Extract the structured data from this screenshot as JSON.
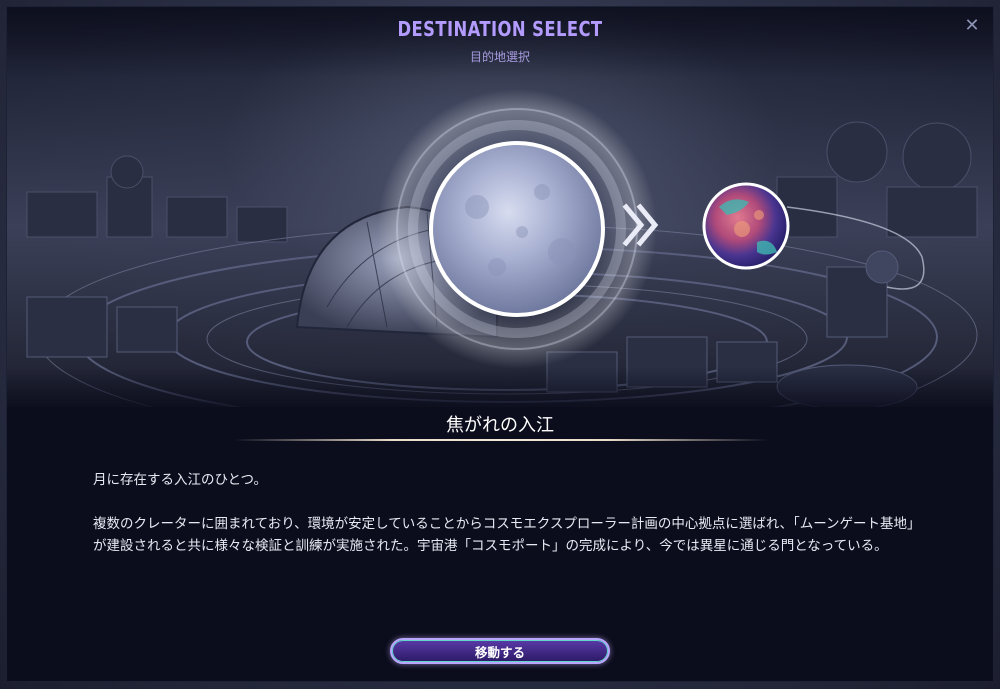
{
  "header": {
    "title": "DESTINATION SELECT",
    "subtitle": "目的地選択",
    "close_glyph": "✕"
  },
  "destination": {
    "name": "焦がれの入江",
    "description": [
      "月に存在する入江のひとつ。",
      "複数のクレーターに囲まれており、環境が安定していることからコスモエクスプローラー計画の中心拠点に選ばれ、「ムーンゲート基地」が建設されると共に様々な検証と訓練が実施された。宇宙港「コスモポート」の完成により、今では異星に通じる門となっている。"
    ]
  },
  "actions": {
    "move_label": "移動する"
  },
  "icons": {
    "close": "close-icon",
    "arrow": "double-chevron-right-icon",
    "moon": "moon-planet-icon",
    "alien_planet": "alien-planet-icon"
  },
  "colors": {
    "title_accent": "#b49cff",
    "dialog_bg": "#0b0d1c",
    "button_border": "#b8a6ff"
  }
}
